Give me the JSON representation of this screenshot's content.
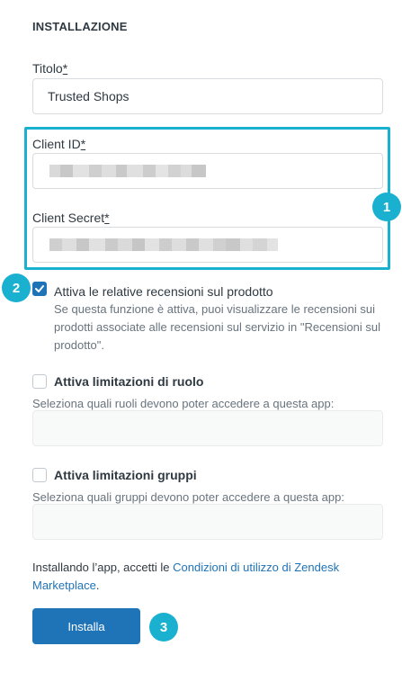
{
  "section": {
    "title": "INSTALLAZIONE"
  },
  "title_field": {
    "label": "Titolo",
    "required_mark": "*",
    "value": "Trusted Shops"
  },
  "client_id": {
    "label": "Client ID",
    "required_mark": "*"
  },
  "client_secret": {
    "label": "Client Secret",
    "required_mark": "*"
  },
  "annotations": {
    "badge1": "1",
    "badge2": "2",
    "badge3": "3",
    "color": "#1ab0d0"
  },
  "reviews_option": {
    "checked": true,
    "label": "Attiva le relative recensioni sul prodotto",
    "hint": "Se questa funzione è attiva, puoi visualizzare le recensioni sui prodotti associate alle recensioni sul servizio in \"Recensioni sul prodotto\"."
  },
  "role_restrictions": {
    "checked": false,
    "label": "Attiva limitazioni di ruolo",
    "hint": "Seleziona quali ruoli devono poter accedere a questa app:"
  },
  "group_restrictions": {
    "checked": false,
    "label": "Attiva limitazioni gruppi",
    "hint": "Seleziona quali gruppi devono poter accedere a questa app:"
  },
  "terms": {
    "prefix": "Installando l’app, accetti le ",
    "link": "Condizioni di utilizzo di Zendesk Marketplace",
    "suffix": "."
  },
  "install_button": {
    "label": "Installa"
  },
  "colors": {
    "primary": "#1f73b7",
    "accent": "#1ab0d0",
    "text": "#2f3941",
    "muted": "#68737d"
  }
}
